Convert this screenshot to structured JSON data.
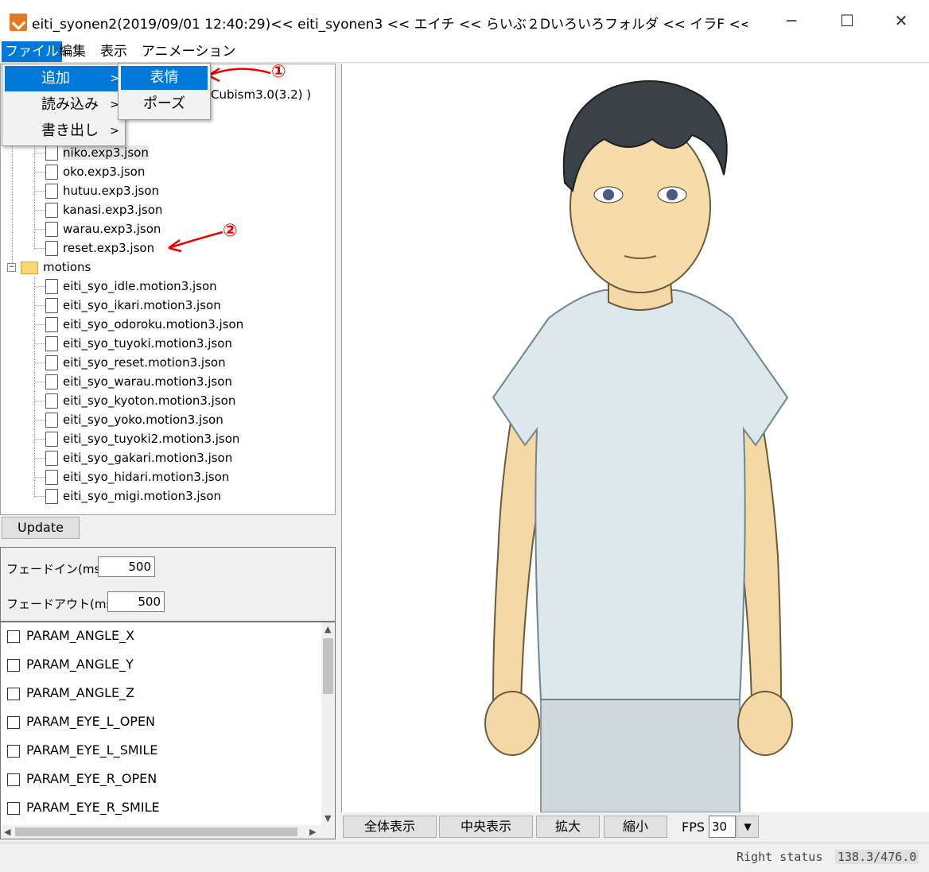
{
  "window": {
    "title": "eiti_syonen2(2019/09/01 12:40:29)<< eiti_syonen3 << エイチ << らいぶ２Dいろいろフォルダ << イラF  << D:",
    "minimize": "─",
    "maximize": "☐",
    "close": "✕"
  },
  "menu": [
    "ファイル",
    "編集",
    "表示",
    "アニメーション"
  ],
  "context_menu": {
    "items": [
      {
        "label": "追加",
        "chevron": ">"
      },
      {
        "label": "読み込み",
        "chevron": ">"
      },
      {
        "label": "書き出し",
        "chevron": ">"
      }
    ],
    "submenu": [
      "表情",
      "ポーズ"
    ]
  },
  "tree": {
    "partial_header": "Cubism3.0(3.2) )",
    "expressions": [
      "niko.exp3.json",
      "oko.exp3.json",
      "hutuu.exp3.json",
      "kanasi.exp3.json",
      "warau.exp3.json",
      "reset.exp3.json"
    ],
    "folder_expander": "−",
    "folder": "motions",
    "motions": [
      "eiti_syo_idle.motion3.json",
      "eiti_syo_ikari.motion3.json",
      "eiti_syo_odoroku.motion3.json",
      "eiti_syo_tuyoki.motion3.json",
      "eiti_syo_reset.motion3.json",
      "eiti_syo_warau.motion3.json",
      "eiti_syo_kyoton.motion3.json",
      "eiti_syo_yoko.motion3.json",
      "eiti_syo_tuyoki2.motion3.json",
      "eiti_syo_gakari.motion3.json",
      "eiti_syo_hidari.motion3.json",
      "eiti_syo_migi.motion3.json"
    ]
  },
  "update_label": "Update",
  "fade": {
    "in_label": "フェードイン(ms)",
    "in_value": "500",
    "out_label": "フェードアウト(ms)",
    "out_value": "500"
  },
  "params": [
    "PARAM_ANGLE_X",
    "PARAM_ANGLE_Y",
    "PARAM_ANGLE_Z",
    "PARAM_EYE_L_OPEN",
    "PARAM_EYE_L_SMILE",
    "PARAM_EYE_R_OPEN",
    "PARAM_EYE_R_SMILE"
  ],
  "viewer_buttons": [
    "全体表示",
    "中央表示",
    "拡大",
    "縮小"
  ],
  "fps": {
    "label": "FPS",
    "value": "30",
    "dropdown": "▼"
  },
  "status": {
    "label": "Right status",
    "value": "138.3/476.0"
  },
  "annotations": [
    "①",
    "②"
  ],
  "colors": {
    "selection": "#0078d7",
    "annotation": "#e00000"
  }
}
